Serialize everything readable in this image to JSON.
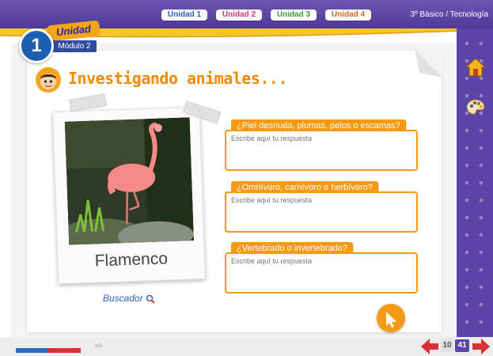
{
  "header": {
    "units": [
      {
        "label": "Unidad 1",
        "color": "#2f5fb0"
      },
      {
        "label": "Unidad 2",
        "color": "#d53a6a"
      },
      {
        "label": "Unidad 3",
        "color": "#3c9c3a"
      },
      {
        "label": "Unidad 4",
        "color": "#d66a1a"
      }
    ],
    "grade_label": "3º Básico / Tecnología"
  },
  "badge": {
    "number": "1",
    "unidad_label": "Unidad",
    "modulo_label": "Módulo 2"
  },
  "title": "Investigando animales...",
  "photo": {
    "caption": "Flamenco"
  },
  "buscador_label": "Buscador",
  "questions": [
    {
      "label": "¿Piel desnuda, plumas, pelos o escamas?",
      "placeholder": "Escribe aquí tu respuesta"
    },
    {
      "label": "¿Omnívoro, carnívoro o herbívoro?",
      "placeholder": "Escribe aquí tu respuesta"
    },
    {
      "label": "¿Vertebrado o invertebrado?",
      "placeholder": "Escribe aquí tu respuesta"
    }
  ],
  "sidebar": {
    "icons": [
      "home-icon",
      "palette-icon"
    ]
  },
  "footer": {
    "code": "s02",
    "current_page": "10",
    "total_pages": "41"
  },
  "colors": {
    "accent_orange": "#f59a12",
    "title_orange": "#f08a00",
    "top_bar_purple": "#5a44a7",
    "badge_blue": "#1b5fb0"
  }
}
